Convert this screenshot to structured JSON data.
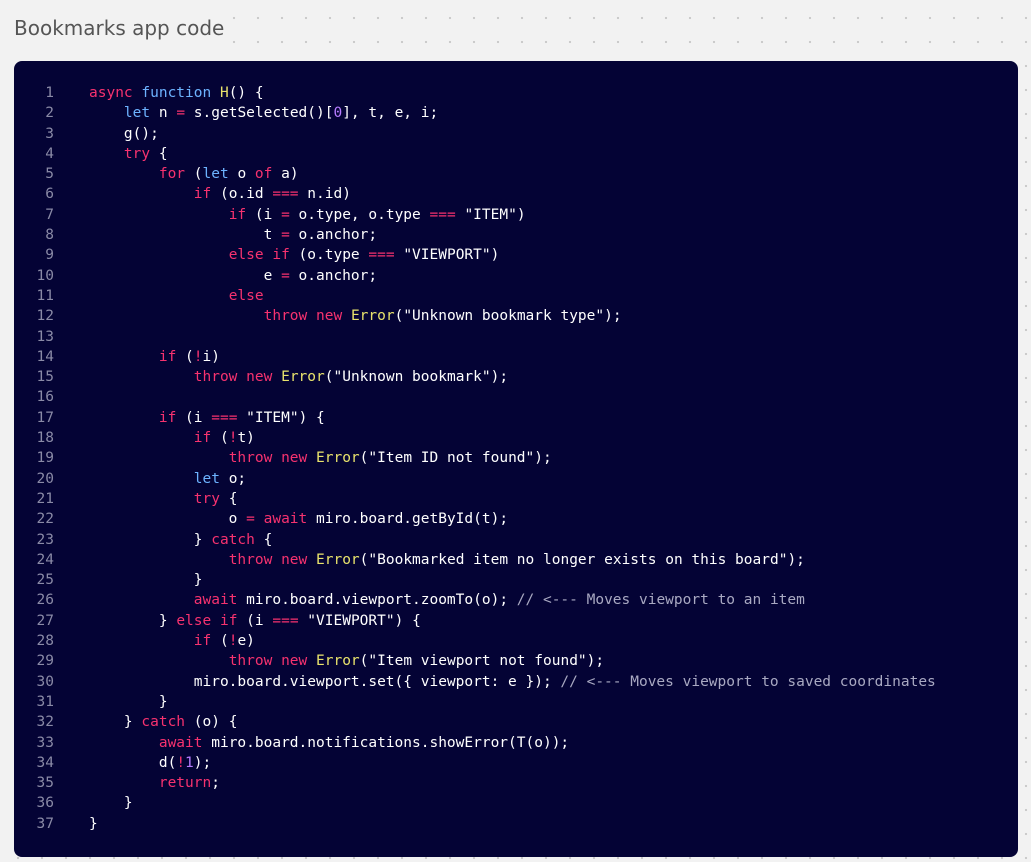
{
  "frame": {
    "title": "Bookmarks app code"
  },
  "colors": {
    "canvas_background": "#f2f2f2",
    "code_background": "#040335",
    "keyword": "#f7326f",
    "declaration_keyword": "#6db3ff",
    "function_name": "#e9e36c",
    "string": "#ffffff",
    "comment": "#a9a9c2",
    "number": "#b67bff",
    "line_number": "#8a8aa6"
  },
  "code": {
    "language": "javascript",
    "lines": [
      {
        "n": "1",
        "t": [
          [
            "kw",
            "async"
          ],
          [
            "id",
            " "
          ],
          [
            "kw2",
            "function"
          ],
          [
            "id",
            " "
          ],
          [
            "fn",
            "H"
          ],
          [
            "id",
            "() {"
          ]
        ]
      },
      {
        "n": "2",
        "t": [
          [
            "id",
            "    "
          ],
          [
            "kw2",
            "let"
          ],
          [
            "id",
            " n "
          ],
          [
            "op",
            "="
          ],
          [
            "id",
            " s.getSelected()["
          ],
          [
            "num",
            "0"
          ],
          [
            "id",
            "], t, e, i;"
          ]
        ]
      },
      {
        "n": "3",
        "t": [
          [
            "id",
            "    g();"
          ]
        ]
      },
      {
        "n": "4",
        "t": [
          [
            "id",
            "    "
          ],
          [
            "kw",
            "try"
          ],
          [
            "id",
            " {"
          ]
        ]
      },
      {
        "n": "5",
        "t": [
          [
            "id",
            "        "
          ],
          [
            "kw",
            "for"
          ],
          [
            "id",
            " ("
          ],
          [
            "kw2",
            "let"
          ],
          [
            "id",
            " o "
          ],
          [
            "kw",
            "of"
          ],
          [
            "id",
            " a)"
          ]
        ]
      },
      {
        "n": "6",
        "t": [
          [
            "id",
            "            "
          ],
          [
            "kw",
            "if"
          ],
          [
            "id",
            " (o.id "
          ],
          [
            "op",
            "==="
          ],
          [
            "id",
            " n.id)"
          ]
        ]
      },
      {
        "n": "7",
        "t": [
          [
            "id",
            "                "
          ],
          [
            "kw",
            "if"
          ],
          [
            "id",
            " (i "
          ],
          [
            "op",
            "="
          ],
          [
            "id",
            " o.type, o.type "
          ],
          [
            "op",
            "==="
          ],
          [
            "id",
            " "
          ],
          [
            "str",
            "\"ITEM\""
          ],
          [
            "id",
            ")"
          ]
        ]
      },
      {
        "n": "8",
        "t": [
          [
            "id",
            "                    t "
          ],
          [
            "op",
            "="
          ],
          [
            "id",
            " o.anchor;"
          ]
        ]
      },
      {
        "n": "9",
        "t": [
          [
            "id",
            "                "
          ],
          [
            "kw",
            "else"
          ],
          [
            "id",
            " "
          ],
          [
            "kw",
            "if"
          ],
          [
            "id",
            " (o.type "
          ],
          [
            "op",
            "==="
          ],
          [
            "id",
            " "
          ],
          [
            "str",
            "\"VIEWPORT\""
          ],
          [
            "id",
            ")"
          ]
        ]
      },
      {
        "n": "10",
        "t": [
          [
            "id",
            "                    e "
          ],
          [
            "op",
            "="
          ],
          [
            "id",
            " o.anchor;"
          ]
        ]
      },
      {
        "n": "11",
        "t": [
          [
            "id",
            "                "
          ],
          [
            "kw",
            "else"
          ]
        ]
      },
      {
        "n": "12",
        "t": [
          [
            "id",
            "                    "
          ],
          [
            "kw",
            "throw"
          ],
          [
            "id",
            " "
          ],
          [
            "kw",
            "new"
          ],
          [
            "id",
            " "
          ],
          [
            "fn",
            "Error"
          ],
          [
            "id",
            "("
          ],
          [
            "str",
            "\"Unknown bookmark type\""
          ],
          [
            "id",
            ");"
          ]
        ]
      },
      {
        "n": "13",
        "t": []
      },
      {
        "n": "14",
        "t": [
          [
            "id",
            "        "
          ],
          [
            "kw",
            "if"
          ],
          [
            "id",
            " ("
          ],
          [
            "op",
            "!"
          ],
          [
            "id",
            "i)"
          ]
        ]
      },
      {
        "n": "15",
        "t": [
          [
            "id",
            "            "
          ],
          [
            "kw",
            "throw"
          ],
          [
            "id",
            " "
          ],
          [
            "kw",
            "new"
          ],
          [
            "id",
            " "
          ],
          [
            "fn",
            "Error"
          ],
          [
            "id",
            "("
          ],
          [
            "str",
            "\"Unknown bookmark\""
          ],
          [
            "id",
            ");"
          ]
        ]
      },
      {
        "n": "16",
        "t": []
      },
      {
        "n": "17",
        "t": [
          [
            "id",
            "        "
          ],
          [
            "kw",
            "if"
          ],
          [
            "id",
            " (i "
          ],
          [
            "op",
            "==="
          ],
          [
            "id",
            " "
          ],
          [
            "str",
            "\"ITEM\""
          ],
          [
            "id",
            ") {"
          ]
        ]
      },
      {
        "n": "18",
        "t": [
          [
            "id",
            "            "
          ],
          [
            "kw",
            "if"
          ],
          [
            "id",
            " ("
          ],
          [
            "op",
            "!"
          ],
          [
            "id",
            "t)"
          ]
        ]
      },
      {
        "n": "19",
        "t": [
          [
            "id",
            "                "
          ],
          [
            "kw",
            "throw"
          ],
          [
            "id",
            " "
          ],
          [
            "kw",
            "new"
          ],
          [
            "id",
            " "
          ],
          [
            "fn",
            "Error"
          ],
          [
            "id",
            "("
          ],
          [
            "str",
            "\"Item ID not found\""
          ],
          [
            "id",
            ");"
          ]
        ]
      },
      {
        "n": "20",
        "t": [
          [
            "id",
            "            "
          ],
          [
            "kw2",
            "let"
          ],
          [
            "id",
            " o;"
          ]
        ]
      },
      {
        "n": "21",
        "t": [
          [
            "id",
            "            "
          ],
          [
            "kw",
            "try"
          ],
          [
            "id",
            " {"
          ]
        ]
      },
      {
        "n": "22",
        "t": [
          [
            "id",
            "                o "
          ],
          [
            "op",
            "="
          ],
          [
            "id",
            " "
          ],
          [
            "kw",
            "await"
          ],
          [
            "id",
            " miro.board.getById(t);"
          ]
        ]
      },
      {
        "n": "23",
        "t": [
          [
            "id",
            "            } "
          ],
          [
            "kw",
            "catch"
          ],
          [
            "id",
            " {"
          ]
        ]
      },
      {
        "n": "24",
        "t": [
          [
            "id",
            "                "
          ],
          [
            "kw",
            "throw"
          ],
          [
            "id",
            " "
          ],
          [
            "kw",
            "new"
          ],
          [
            "id",
            " "
          ],
          [
            "fn",
            "Error"
          ],
          [
            "id",
            "("
          ],
          [
            "str",
            "\"Bookmarked item no longer exists on this board\""
          ],
          [
            "id",
            ");"
          ]
        ]
      },
      {
        "n": "25",
        "t": [
          [
            "id",
            "            }"
          ]
        ]
      },
      {
        "n": "26",
        "t": [
          [
            "id",
            "            "
          ],
          [
            "kw",
            "await"
          ],
          [
            "id",
            " miro.board.viewport.zoomTo(o); "
          ],
          [
            "cm",
            "// <--- Moves viewport to an item"
          ]
        ]
      },
      {
        "n": "27",
        "t": [
          [
            "id",
            "        } "
          ],
          [
            "kw",
            "else"
          ],
          [
            "id",
            " "
          ],
          [
            "kw",
            "if"
          ],
          [
            "id",
            " (i "
          ],
          [
            "op",
            "==="
          ],
          [
            "id",
            " "
          ],
          [
            "str",
            "\"VIEWPORT\""
          ],
          [
            "id",
            ") {"
          ]
        ]
      },
      {
        "n": "28",
        "t": [
          [
            "id",
            "            "
          ],
          [
            "kw",
            "if"
          ],
          [
            "id",
            " ("
          ],
          [
            "op",
            "!"
          ],
          [
            "id",
            "e)"
          ]
        ]
      },
      {
        "n": "29",
        "t": [
          [
            "id",
            "                "
          ],
          [
            "kw",
            "throw"
          ],
          [
            "id",
            " "
          ],
          [
            "kw",
            "new"
          ],
          [
            "id",
            " "
          ],
          [
            "fn",
            "Error"
          ],
          [
            "id",
            "("
          ],
          [
            "str",
            "\"Item viewport not found\""
          ],
          [
            "id",
            ");"
          ]
        ]
      },
      {
        "n": "30",
        "t": [
          [
            "id",
            "            miro.board.viewport.set({ viewport: e }); "
          ],
          [
            "cm",
            "// <--- Moves viewport to saved coordinates"
          ]
        ]
      },
      {
        "n": "31",
        "t": [
          [
            "id",
            "        }"
          ]
        ]
      },
      {
        "n": "32",
        "t": [
          [
            "id",
            "    } "
          ],
          [
            "kw",
            "catch"
          ],
          [
            "id",
            " (o) {"
          ]
        ]
      },
      {
        "n": "33",
        "t": [
          [
            "id",
            "        "
          ],
          [
            "kw",
            "await"
          ],
          [
            "id",
            " miro.board.notifications.showError(T(o));"
          ]
        ]
      },
      {
        "n": "34",
        "t": [
          [
            "id",
            "        d("
          ],
          [
            "op",
            "!"
          ],
          [
            "num",
            "1"
          ],
          [
            "id",
            ");"
          ]
        ]
      },
      {
        "n": "35",
        "t": [
          [
            "id",
            "        "
          ],
          [
            "kw",
            "return"
          ],
          [
            "id",
            ";"
          ]
        ]
      },
      {
        "n": "36",
        "t": [
          [
            "id",
            "    }"
          ]
        ]
      },
      {
        "n": "37",
        "t": [
          [
            "id",
            "}"
          ]
        ]
      }
    ]
  }
}
